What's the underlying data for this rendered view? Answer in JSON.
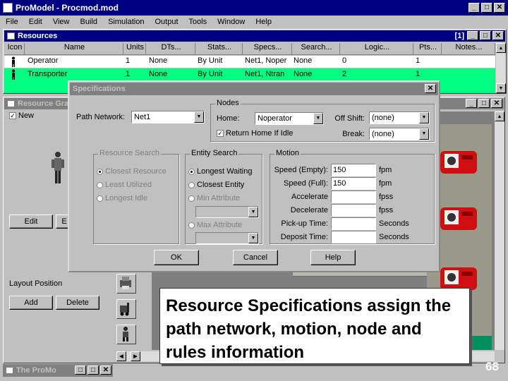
{
  "app": {
    "title": "ProModel - Procmod.mod",
    "menu": [
      "File",
      "Edit",
      "View",
      "Build",
      "Simulation",
      "Output",
      "Tools",
      "Window",
      "Help"
    ]
  },
  "resources_window": {
    "title": "Resources",
    "counter": "[1]",
    "columns": [
      "Icon",
      "Name",
      "Units",
      "DTs...",
      "Stats...",
      "Specs...",
      "Search...",
      "Logic...",
      "Pts...",
      "Notes..."
    ],
    "rows": [
      {
        "name": "Operator",
        "units": "1",
        "dts": "None",
        "stats": "By Unit",
        "specs": "Net1, Noper",
        "search": "None",
        "logic": "0",
        "pts": "1",
        "notes": ""
      },
      {
        "name": "Transporter",
        "units": "1",
        "dts": "None",
        "stats": "By Unit",
        "specs": "Net1, Ntran",
        "search": "None",
        "logic": "2",
        "pts": "1",
        "notes": ""
      }
    ]
  },
  "graphics_window": {
    "title": "Resource Gra",
    "new_label": "New",
    "edit_label": "Edit",
    "layout_position_label": "Layout Position",
    "add_label": "Add",
    "delete_label": "Delete"
  },
  "taskbar": {
    "minimized_title": "The ProMo"
  },
  "dialog": {
    "title": "Specifications",
    "path_network_label": "Path Network:",
    "path_network_value": "Net1",
    "nodes": {
      "group_label": "Nodes",
      "home_label": "Home:",
      "home_value": "Noperator",
      "return_home_label": "Return Home If Idle",
      "off_shift_label": "Off Shift:",
      "off_shift_value": "(none)",
      "break_label": "Break:",
      "break_value": "(none)"
    },
    "resource_search": {
      "group_label": "Resource Search",
      "options": [
        "Closest Resource",
        "Least Utilized",
        "Longest Idle"
      ]
    },
    "entity_search": {
      "group_label": "Entity Search",
      "options": [
        "Longest Waiting",
        "Closest Entity",
        "Min Attribute",
        "Max Attribute"
      ]
    },
    "motion": {
      "group_label": "Motion",
      "fields": [
        {
          "label": "Speed (Empty):",
          "value": "150",
          "unit": "fpm"
        },
        {
          "label": "Speed (Full):",
          "value": "150",
          "unit": "fpm"
        },
        {
          "label": "Accelerate",
          "value": "",
          "unit": "fpss"
        },
        {
          "label": "Decelerate",
          "value": "",
          "unit": "fpss"
        },
        {
          "label": "Pick-up Time:",
          "value": "",
          "unit": "Seconds"
        },
        {
          "label": "Deposit Time:",
          "value": "",
          "unit": "Seconds"
        }
      ]
    },
    "ok_label": "OK",
    "cancel_label": "Cancel",
    "help_label": "Help"
  },
  "caption": {
    "text": "Resource Specifications assign the path network, motion, node and rules information"
  },
  "page_number": "68",
  "colors": {
    "title_active": "#000080",
    "row_highlight": "#00ff80",
    "desktop": "#c0c0c0"
  }
}
